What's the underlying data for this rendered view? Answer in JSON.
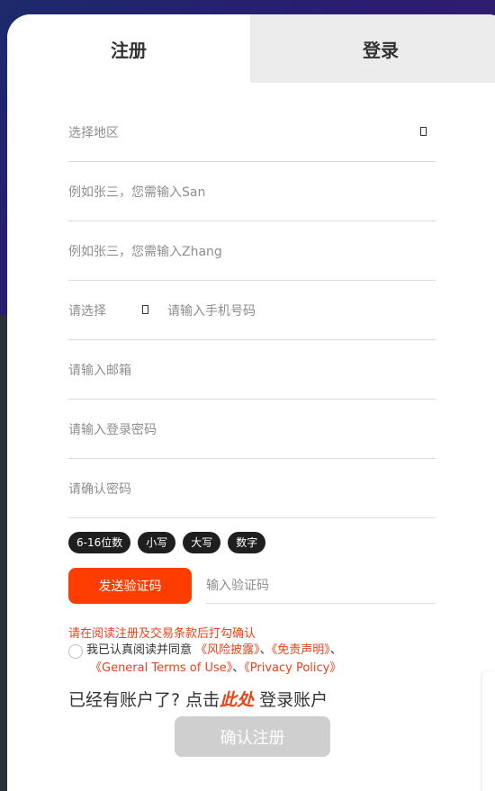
{
  "tabs": {
    "register": "注册",
    "login": "登录"
  },
  "form": {
    "region_placeholder": "选择地区",
    "firstname_placeholder": "例如张三，您需输入San",
    "lastname_placeholder": "例如张三，您需输入Zhang",
    "phone_code_placeholder": "请选择",
    "phone_placeholder": "请输入手机号码",
    "email_placeholder": "请输入邮箱",
    "password_placeholder": "请输入登录密码",
    "confirm_password_placeholder": "请确认密码"
  },
  "password_rules": [
    "6-16位数",
    "小写",
    "大写",
    "数字"
  ],
  "verify": {
    "send_label": "发送验证码",
    "code_placeholder": "输入验证码"
  },
  "agreement": {
    "warning": "请在阅读注册及交易条款后打勾确认",
    "prefix": "我已认真阅读并同意",
    "risk": "《风险披露》",
    "sep1": "、",
    "disclaimer": "《免责声明》",
    "sep2": "、",
    "terms": "《General Terms of Use》",
    "sep3": "、",
    "privacy": "《Privacy Policy》"
  },
  "login_prompt": {
    "prefix": "已经有账户了? 点击",
    "here": "此处",
    "suffix": " 登录账户"
  },
  "confirm_label": "确认注册",
  "colors": {
    "accent": "#ff3d00",
    "link": "#e8431a",
    "disabled": "#cfcfcf"
  }
}
